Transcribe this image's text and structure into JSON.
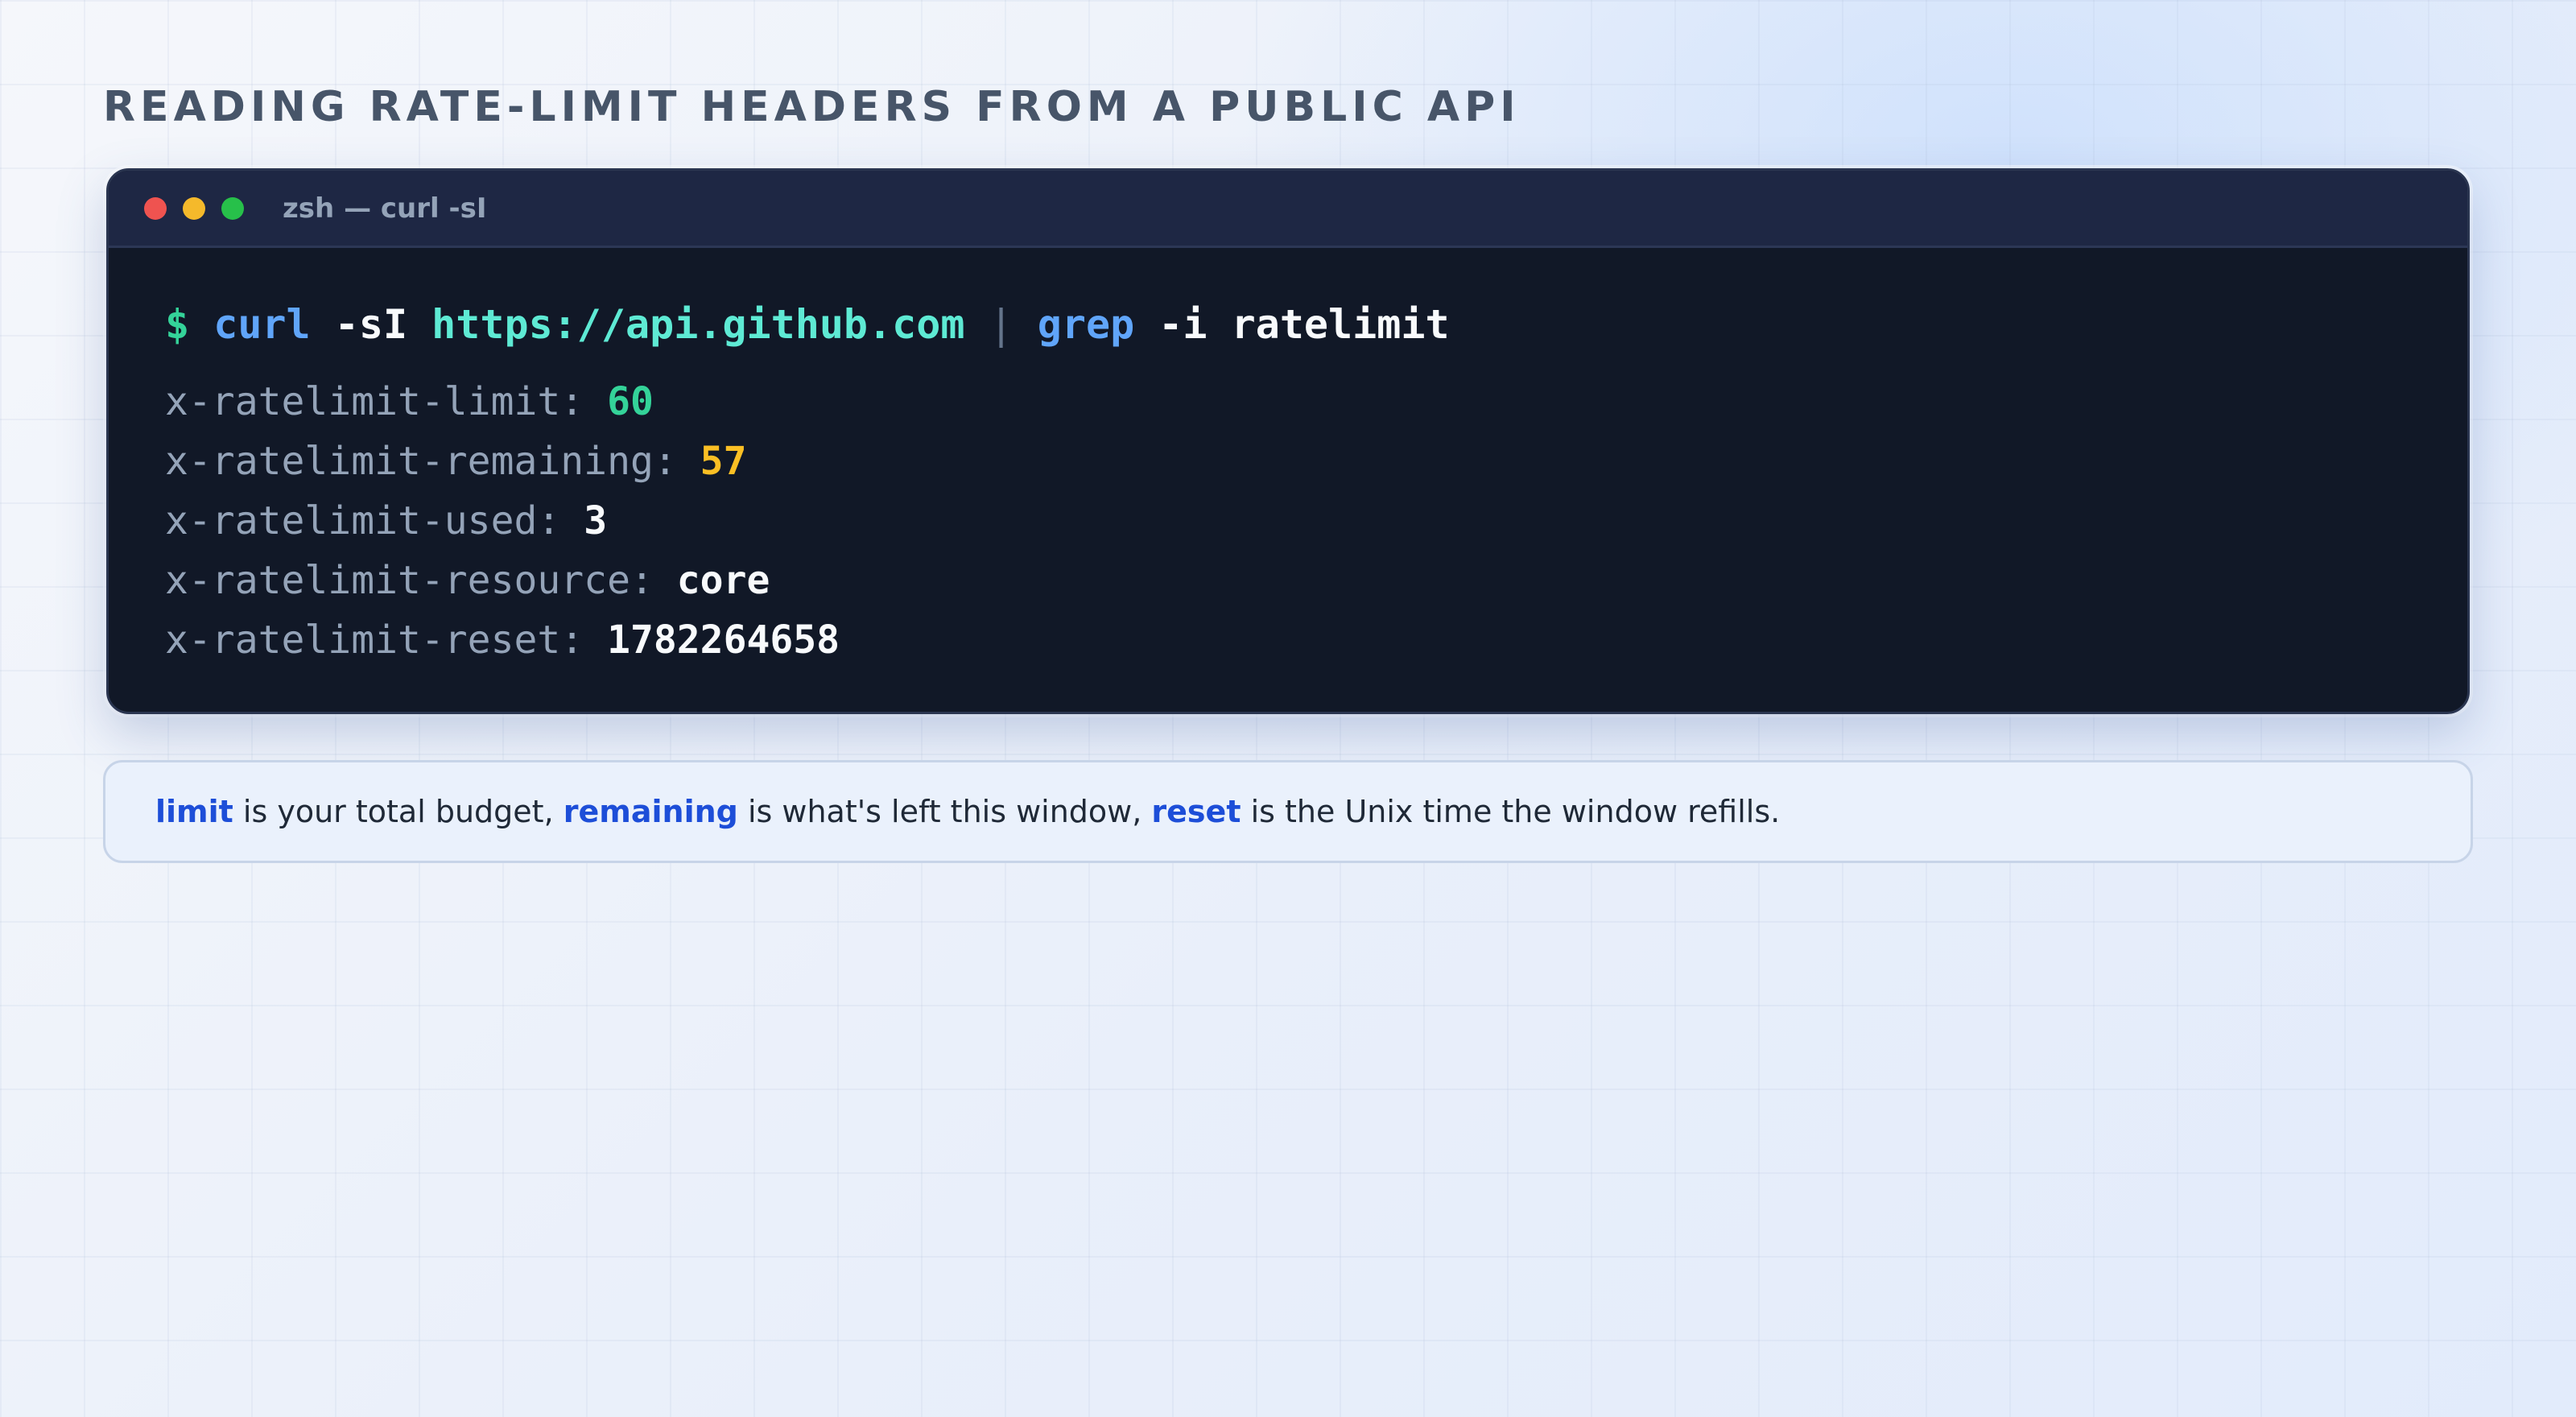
{
  "page": {
    "title": "READING RATE-LIMIT HEADERS FROM A PUBLIC API"
  },
  "terminal": {
    "window_title": "zsh — curl -sI",
    "traffic_lights": [
      "close",
      "minimize",
      "zoom"
    ],
    "command": {
      "prompt": "$",
      "program": "curl",
      "flags": "-sI",
      "url": "https://api.github.com",
      "pipe": "|",
      "program2": "grep",
      "flags2": "-i",
      "pattern": "ratelimit"
    },
    "output": [
      {
        "key": "x-ratelimit-limit:",
        "value": "60"
      },
      {
        "key": "x-ratelimit-remaining:",
        "value": "57"
      },
      {
        "key": "x-ratelimit-used:",
        "value": "3"
      },
      {
        "key": "x-ratelimit-resource:",
        "value": "core"
      },
      {
        "key": "x-ratelimit-reset:",
        "value": "1782264658"
      }
    ]
  },
  "note": {
    "kw1": "limit",
    "text1": " is your total budget, ",
    "kw2": "remaining",
    "text2": " is what's left this window, ",
    "kw3": "reset",
    "text3": " is the Unix time the window refills."
  },
  "colors": {
    "accent": "#1d4ed8",
    "terminal_bg": "#111827",
    "value_green": "#34d399",
    "value_yellow": "#fbbf24"
  }
}
